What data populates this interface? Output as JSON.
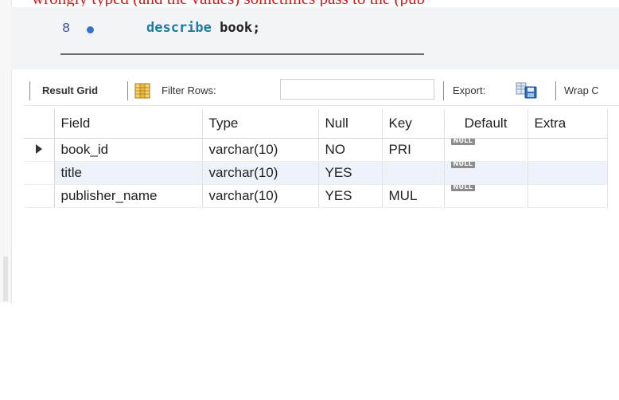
{
  "top_caption": "wrongly typed (and the values) sometimes pass to the (pub",
  "editor": {
    "line_number": "8",
    "sql_keyword": "describe",
    "sql_rest": "book;"
  },
  "toolbar": {
    "result_grid_label": "Result Grid",
    "grid_icon": "grid-columns-icon",
    "filter_label": "Filter Rows:",
    "filter_value": "",
    "export_label": "Export:",
    "export_icon": "export-save-icon",
    "wrap_label": "Wrap C"
  },
  "table": {
    "columns": [
      "Field",
      "Type",
      "Null",
      "Key",
      "Default",
      "Extra"
    ],
    "rows": [
      {
        "field": "book_id",
        "type": "varchar(10)",
        "null": "NO",
        "key": "PRI",
        "default": "NULL",
        "extra": ""
      },
      {
        "field": "title",
        "type": "varchar(10)",
        "null": "YES",
        "key": "",
        "default": "NULL",
        "extra": ""
      },
      {
        "field": "publisher_name",
        "type": "varchar(10)",
        "null": "YES",
        "key": "MUL",
        "default": "NULL",
        "extra": ""
      }
    ],
    "current_row_marker": "row-pointer-icon"
  },
  "colors": {
    "caption_red": "#d21b1b",
    "keyword_blue": "#1f7a9e",
    "alt_row": "#eef3fb",
    "null_badge": "#8d8d8d"
  }
}
